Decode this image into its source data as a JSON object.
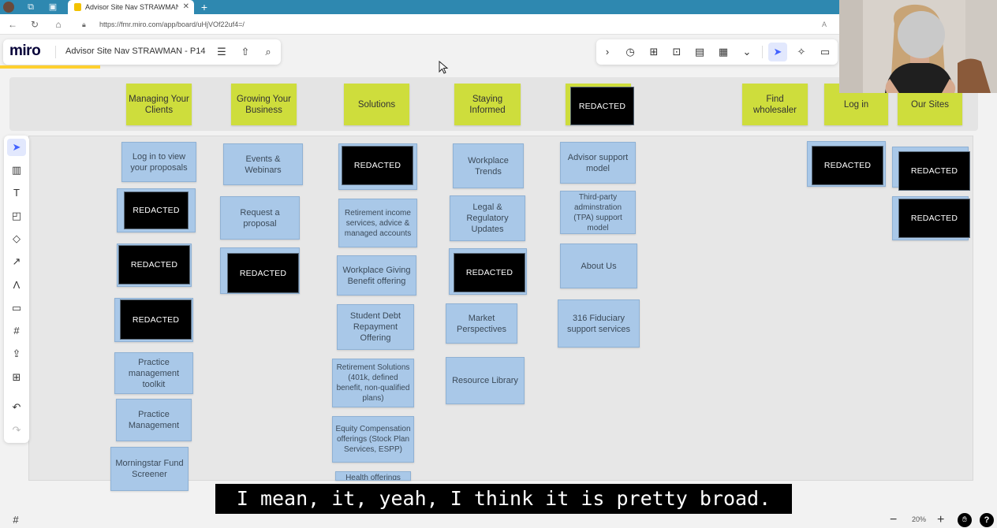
{
  "browser": {
    "tab_title": "Advisor Site Nav STRAWMAN - P",
    "tab_close": "✕",
    "new_tab": "+",
    "url": "https://fmr.miro.com/app/board/uHjVOf22uf4=/"
  },
  "miro": {
    "logo": "miro",
    "board_title": "Advisor Site Nav STRAWMAN - P14"
  },
  "header_stickies": [
    {
      "text": "Managing Your Clients"
    },
    {
      "text": "Growing Your Business"
    },
    {
      "text": "Solutions"
    },
    {
      "text": "Staying Informed"
    },
    {
      "text": "REDACTED"
    },
    {
      "text": "Find wholesaler"
    },
    {
      "text": "Log in"
    },
    {
      "text": "Our Sites"
    }
  ],
  "columns": {
    "managing": [
      "Log in to view your proposals",
      "REDACTED",
      "REDACTED",
      "REDACTED",
      "Practice management toolkit",
      "Practice Management",
      "Morningstar Fund Screener"
    ],
    "growing": [
      "Events & Webinars",
      "Request a proposal",
      "REDACTED"
    ],
    "solutions": [
      "REDACTED",
      "Retirement income services, advice & managed accounts",
      "Workplace Giving Benefit offering",
      "Student Debt Repayment Offering",
      "Retirement Solutions (401k, defined benefit, non-qualified plans)",
      "Equity Compensation offerings (Stock Plan Services, ESPP)",
      "Health offerings"
    ],
    "staying": [
      "Workplace Trends",
      "Legal & Regulatory Updates",
      "REDACTED",
      "Market Perspectives",
      "Resource Library"
    ],
    "redacted_col": [
      "Advisor support model",
      "Third-party adminstration (TPA) support model",
      "About Us",
      "316 Fiduciary support services"
    ],
    "login": [
      "REDACTED"
    ],
    "our_sites": [
      "REDACTED",
      "REDACTED"
    ]
  },
  "caption": "I mean, it, yeah, I think it is pretty broad.",
  "zoom": {
    "level": "20%",
    "minus": "−",
    "plus": "+",
    "help": "?"
  }
}
